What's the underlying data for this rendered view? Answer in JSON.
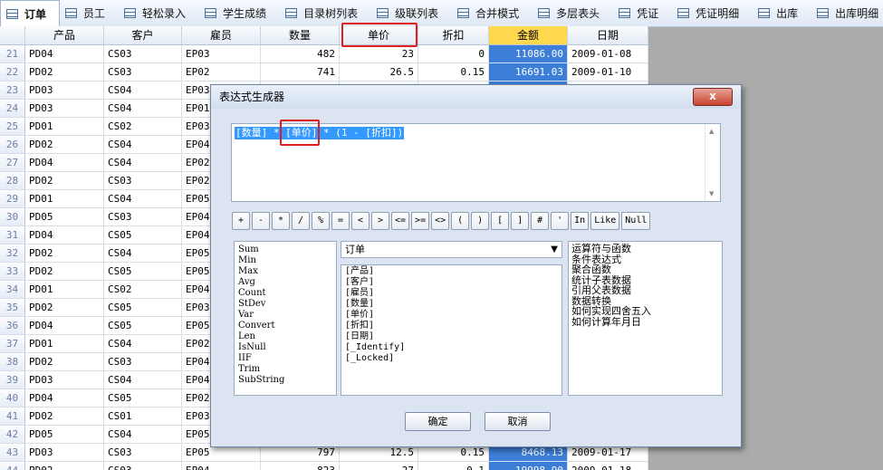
{
  "tabs": [
    {
      "label": "订单",
      "active": true
    },
    {
      "label": "员工"
    },
    {
      "label": "轻松录入"
    },
    {
      "label": "学生成绩"
    },
    {
      "label": "目录树列表"
    },
    {
      "label": "级联列表"
    },
    {
      "label": "合并模式"
    },
    {
      "label": "多层表头"
    },
    {
      "label": "凭证"
    },
    {
      "label": "凭证明细"
    },
    {
      "label": "出库"
    },
    {
      "label": "出库明细"
    }
  ],
  "grid": {
    "columns": [
      "",
      "产品",
      "客户",
      "雇员",
      "数量",
      "单价",
      "折扣",
      "金额",
      "日期"
    ],
    "rows": [
      [
        "21",
        "PD04",
        "CS03",
        "EP03",
        "482",
        "23",
        "0",
        "11086.00",
        "2009-01-08"
      ],
      [
        "22",
        "PD02",
        "CS03",
        "EP02",
        "741",
        "26.5",
        "0.15",
        "16691.03",
        "2009-01-10"
      ],
      [
        "23",
        "PD03",
        "CS04",
        "EP03",
        "",
        "",
        "",
        "",
        ""
      ],
      [
        "24",
        "PD03",
        "CS04",
        "EP01",
        "",
        "",
        "",
        "",
        ""
      ],
      [
        "25",
        "PD01",
        "CS02",
        "EP03",
        "",
        "",
        "",
        "",
        ""
      ],
      [
        "26",
        "PD02",
        "CS04",
        "EP04",
        "",
        "",
        "",
        "",
        ""
      ],
      [
        "27",
        "PD04",
        "CS04",
        "EP02",
        "",
        "",
        "",
        "",
        ""
      ],
      [
        "28",
        "PD02",
        "CS03",
        "EP02",
        "",
        "",
        "",
        "",
        ""
      ],
      [
        "29",
        "PD01",
        "CS04",
        "EP05",
        "",
        "",
        "",
        "",
        ""
      ],
      [
        "30",
        "PD05",
        "CS03",
        "EP04",
        "",
        "",
        "",
        "",
        ""
      ],
      [
        "31",
        "PD04",
        "CS05",
        "EP04",
        "",
        "",
        "",
        "",
        ""
      ],
      [
        "32",
        "PD02",
        "CS04",
        "EP05",
        "",
        "",
        "",
        "",
        ""
      ],
      [
        "33",
        "PD02",
        "CS05",
        "EP05",
        "",
        "",
        "",
        "",
        ""
      ],
      [
        "34",
        "PD01",
        "CS02",
        "EP04",
        "",
        "",
        "",
        "",
        ""
      ],
      [
        "35",
        "PD02",
        "CS05",
        "EP03",
        "",
        "",
        "",
        "",
        ""
      ],
      [
        "36",
        "PD04",
        "CS05",
        "EP05",
        "",
        "",
        "",
        "",
        ""
      ],
      [
        "37",
        "PD01",
        "CS04",
        "EP02",
        "",
        "",
        "",
        "",
        ""
      ],
      [
        "38",
        "PD02",
        "CS03",
        "EP04",
        "",
        "",
        "",
        "",
        ""
      ],
      [
        "39",
        "PD03",
        "CS04",
        "EP04",
        "",
        "",
        "",
        "",
        ""
      ],
      [
        "40",
        "PD04",
        "CS05",
        "EP02",
        "",
        "",
        "",
        "",
        ""
      ],
      [
        "41",
        "PD02",
        "CS01",
        "EP03",
        "",
        "",
        "",
        "",
        ""
      ],
      [
        "42",
        "PD05",
        "CS04",
        "EP05",
        "",
        "",
        "",
        "",
        ""
      ],
      [
        "43",
        "PD03",
        "CS03",
        "EP05",
        "797",
        "12.5",
        "0.15",
        "8468.13",
        "2009-01-17"
      ],
      [
        "44",
        "PD02",
        "CS03",
        "EP04",
        "823",
        "27",
        "0.1",
        "19998.90",
        "2009-01-18"
      ]
    ]
  },
  "dialog": {
    "title": "表达式生成器",
    "close_label": "x",
    "expression": "[数量] * [单价] * (1 - [折扣])",
    "operators": [
      "+",
      "-",
      "*",
      "/",
      "%",
      "=",
      "<",
      ">",
      "<=",
      ">=",
      "<>",
      "(",
      ")",
      "[",
      "]",
      "#",
      "'",
      "In",
      "Like",
      "Null"
    ],
    "functions": [
      "Sum",
      "Min",
      "Max",
      "Avg",
      "Count",
      "StDev",
      "Var",
      "Convert",
      "Len",
      "IsNull",
      "IIF",
      "Trim",
      "SubString"
    ],
    "table_select": "订单",
    "fields": [
      "[产品]",
      "[客户]",
      "[雇员]",
      "[数量]",
      "[单价]",
      "[折扣]",
      "[日期]",
      "[_Identify]",
      "[_Locked]"
    ],
    "help_topics": [
      "运算符与函数",
      "条件表达式",
      "聚合函数",
      "统计子表数据",
      "引用父表数据",
      "数据转换",
      "如何实现四舍五入",
      "如何计算年月日"
    ],
    "ok_label": "确定",
    "cancel_label": "取消"
  }
}
